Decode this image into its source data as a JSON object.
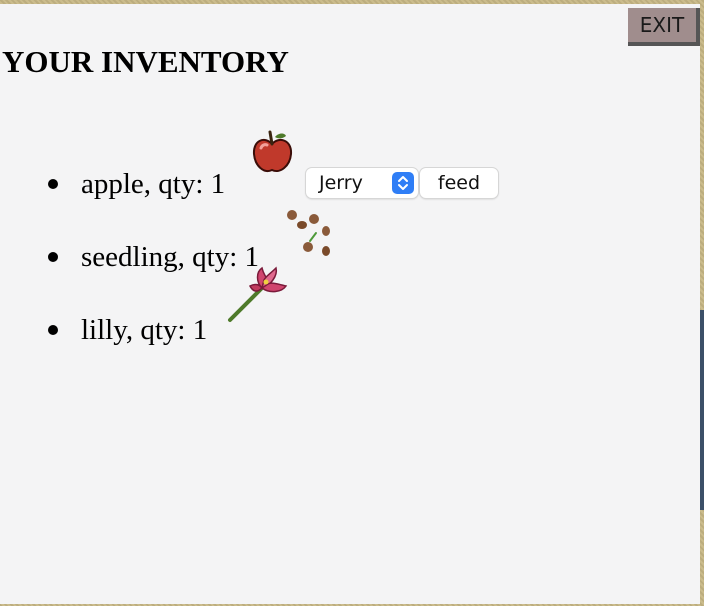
{
  "header": {
    "exit_label": "EXIT",
    "title": "YOUR INVENTORY"
  },
  "inventory": {
    "items": [
      {
        "label": "apple, qty: 1",
        "icon": "apple-icon",
        "icon_color": "#c0392b"
      },
      {
        "label": "seedling, qty: 1",
        "icon": "seedling-icon",
        "icon_color": "#8a5a3a"
      },
      {
        "label": "lilly, qty: 1",
        "icon": "lilly-icon",
        "icon_color": "#d0456e"
      }
    ],
    "feed_controls": {
      "selected_pet": "Jerry",
      "feed_label": "feed"
    }
  },
  "colors": {
    "panel_bg": "#f4f4f5",
    "exit_bg": "#a08d8d",
    "select_accent": "#2f7ef6",
    "frame": "#c8b886"
  }
}
